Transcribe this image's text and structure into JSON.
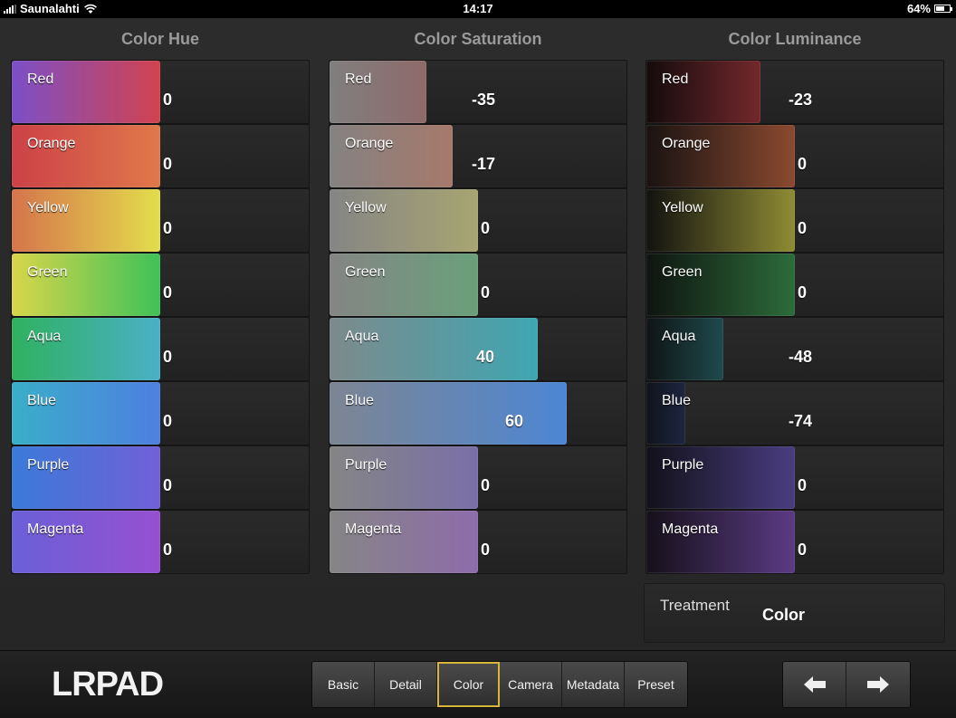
{
  "status_bar": {
    "carrier": "Saunalahti",
    "time": "14:17",
    "battery": "64%",
    "battery_level": 0.64
  },
  "panels": [
    {
      "id": "hue",
      "title": "Color Hue",
      "rows": [
        {
          "label": "Red",
          "value": "0",
          "bar_fraction": 0.5,
          "colors": [
            "#7b4fc8",
            "#d2434f"
          ]
        },
        {
          "label": "Orange",
          "value": "0",
          "bar_fraction": 0.5,
          "colors": [
            "#cc4148",
            "#e0784a"
          ]
        },
        {
          "label": "Yellow",
          "value": "0",
          "bar_fraction": 0.5,
          "colors": [
            "#d5744c",
            "#e3dd4c"
          ]
        },
        {
          "label": "Green",
          "value": "0",
          "bar_fraction": 0.5,
          "colors": [
            "#d8d64a",
            "#3fc158"
          ]
        },
        {
          "label": "Aqua",
          "value": "0",
          "bar_fraction": 0.5,
          "colors": [
            "#2fb160",
            "#4ab0c6"
          ]
        },
        {
          "label": "Blue",
          "value": "0",
          "bar_fraction": 0.5,
          "colors": [
            "#3aaec8",
            "#4e7fe0"
          ]
        },
        {
          "label": "Purple",
          "value": "0",
          "bar_fraction": 0.5,
          "colors": [
            "#3b7ad8",
            "#7160d8"
          ]
        },
        {
          "label": "Magenta",
          "value": "0",
          "bar_fraction": 0.5,
          "colors": [
            "#6a60d8",
            "#9650d0"
          ]
        }
      ]
    },
    {
      "id": "saturation",
      "title": "Color Saturation",
      "rows": [
        {
          "label": "Red",
          "value": "-35",
          "bar_fraction": 0.325,
          "colors": [
            "#807f7f",
            "#8f6a6a"
          ]
        },
        {
          "label": "Orange",
          "value": "-17",
          "bar_fraction": 0.415,
          "colors": [
            "#848282",
            "#a6796b"
          ]
        },
        {
          "label": "Yellow",
          "value": "0",
          "bar_fraction": 0.5,
          "colors": [
            "#858585",
            "#a7a571"
          ]
        },
        {
          "label": "Green",
          "value": "0",
          "bar_fraction": 0.5,
          "colors": [
            "#858585",
            "#6aa07a"
          ]
        },
        {
          "label": "Aqua",
          "value": "40",
          "bar_fraction": 0.7,
          "colors": [
            "#7d8a8c",
            "#3fa6b2"
          ]
        },
        {
          "label": "Blue",
          "value": "60",
          "bar_fraction": 0.8,
          "colors": [
            "#7d8592",
            "#4d86d4"
          ]
        },
        {
          "label": "Purple",
          "value": "0",
          "bar_fraction": 0.5,
          "colors": [
            "#858585",
            "#7a6fa8"
          ]
        },
        {
          "label": "Magenta",
          "value": "0",
          "bar_fraction": 0.5,
          "colors": [
            "#858585",
            "#8e6cab"
          ]
        }
      ]
    },
    {
      "id": "luminance",
      "title": "Color Luminance",
      "rows": [
        {
          "label": "Red",
          "value": "-23",
          "bar_fraction": 0.385,
          "colors": [
            "#140b0c",
            "#73282c"
          ]
        },
        {
          "label": "Orange",
          "value": "0",
          "bar_fraction": 0.5,
          "colors": [
            "#191212",
            "#8b4a30"
          ]
        },
        {
          "label": "Yellow",
          "value": "0",
          "bar_fraction": 0.5,
          "colors": [
            "#121210",
            "#8f8c34"
          ]
        },
        {
          "label": "Green",
          "value": "0",
          "bar_fraction": 0.5,
          "colors": [
            "#0f1410",
            "#2c6c3a"
          ]
        },
        {
          "label": "Aqua",
          "value": "-48",
          "bar_fraction": 0.26,
          "colors": [
            "#0f1415",
            "#1f4a4d"
          ]
        },
        {
          "label": "Blue",
          "value": "-74",
          "bar_fraction": 0.13,
          "colors": [
            "#10131a",
            "#1c2640"
          ]
        },
        {
          "label": "Purple",
          "value": "0",
          "bar_fraction": 0.5,
          "colors": [
            "#12111a",
            "#4a3d80"
          ]
        },
        {
          "label": "Magenta",
          "value": "0",
          "bar_fraction": 0.5,
          "colors": [
            "#15101a",
            "#5b3b84"
          ]
        }
      ]
    }
  ],
  "treatment": {
    "label": "Treatment",
    "value": "Color"
  },
  "toolbar": {
    "logo": "LRPAD",
    "tabs": [
      "Basic",
      "Detail",
      "Color",
      "Camera",
      "Metadata",
      "Preset"
    ],
    "active_tab": "Color",
    "accent_color": "#d8b63a"
  }
}
